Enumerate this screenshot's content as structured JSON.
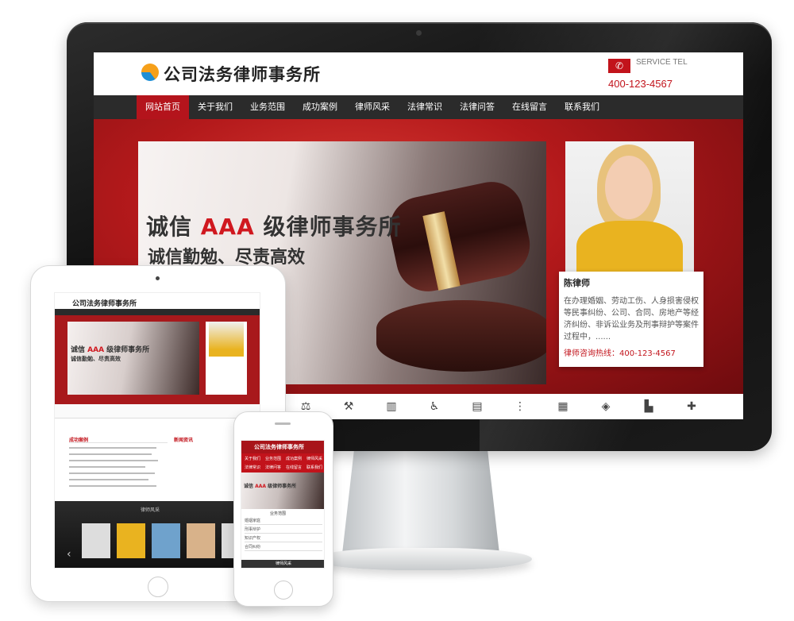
{
  "brand": {
    "logo_text": "公司法务律师事务所",
    "accent": "#c2131b"
  },
  "header": {
    "service_label": "SERVICE TEL",
    "tel": "400-123-4567"
  },
  "nav": [
    {
      "label": "网站首页",
      "active": true
    },
    {
      "label": "关于我们"
    },
    {
      "label": "业务范围"
    },
    {
      "label": "成功案例"
    },
    {
      "label": "律师风采"
    },
    {
      "label": "法律常识"
    },
    {
      "label": "法律问答"
    },
    {
      "label": "在线留言"
    },
    {
      "label": "联系我们"
    }
  ],
  "hero": {
    "title_pre": "诚信 ",
    "title_highlight": "AAA",
    "title_post": " 级律师事务所",
    "subtitle": "诚信勤勉、尽责高效"
  },
  "lawyer": {
    "name": "陈律师",
    "desc": "在办理婚姻、劳动工伤、人身损害侵权等民事纠纷、公司、合同、房地产等经济纠纷、非诉讼业务及刑事辩护等案件过程中，......",
    "hotline_label": "律师咨询热线：",
    "hotline": "400-123-4567"
  },
  "strip_icons": [
    "scale-icon",
    "gavel-icon",
    "building-icon",
    "wheelchair-icon",
    "document-icon",
    "traffic-light-icon",
    "bricks-icon",
    "shield-icon",
    "office-icon",
    "plus-icon"
  ],
  "ipad": {
    "logo": "公司法务律师事务所",
    "banner_title_pre": "诚信 ",
    "banner_title_highlight": "AAA",
    "banner_title_post": " 级律师事务所",
    "banner_sub": "诚信勤勉、尽责高效",
    "section_cases": "成功案例",
    "section_news": "新闻资讯",
    "section_lawyers": "律师风采"
  },
  "iphone": {
    "logo": "公司法务律师事务所",
    "menu": [
      "关于我们",
      "业务范围",
      "成功案例",
      "律师风采",
      "法律常识",
      "法律问答",
      "在线留言",
      "联系我们"
    ],
    "banner_title_pre": "诚信 ",
    "banner_title_highlight": "AAA",
    "banner_title_post": " 级律师事务所",
    "section_business": "业务范围",
    "rows": [
      "婚姻家庭",
      "刑事辩护",
      "知识产权",
      "合同纠纷"
    ],
    "footer": "律师风采"
  }
}
